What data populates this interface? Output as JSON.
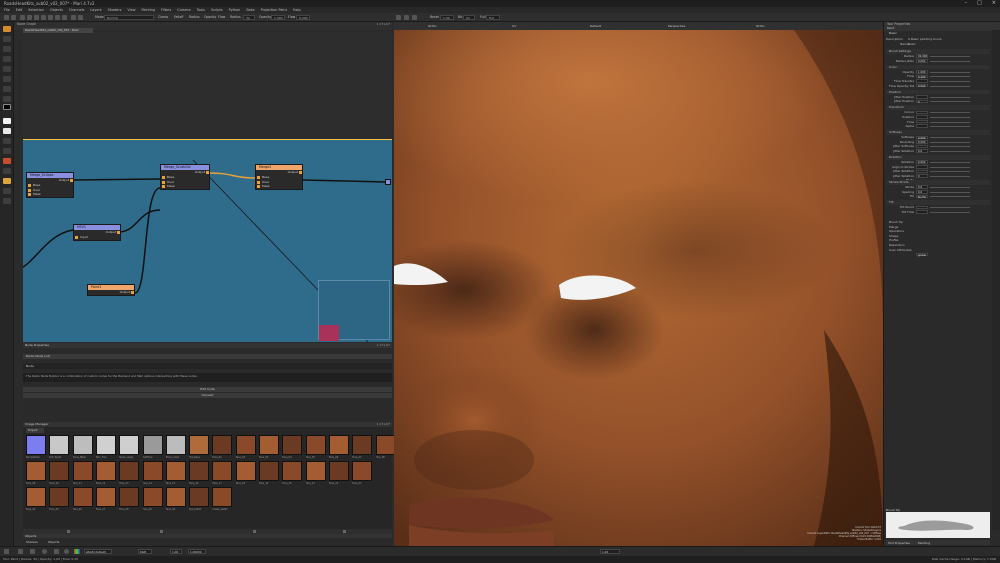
{
  "app": {
    "title": "RoadsHeadKits_sub02_v02_007* - Mari 4.7v2",
    "window_controls": [
      "–",
      "□",
      "×"
    ]
  },
  "menu": [
    "File",
    "Edit",
    "Selection",
    "Objects",
    "Channels",
    "Layers",
    "Shaders",
    "View",
    "Painting",
    "Filters",
    "Camera",
    "Tools",
    "Scripts",
    "Python",
    "Bake",
    "Projection Paint",
    "Help"
  ],
  "toolbar": {
    "mode_label": "Mode",
    "mode_value": "Normal",
    "options": [
      "Clamp",
      "Falloff",
      "Radius",
      "Opacity",
      "Flow"
    ],
    "radius_label": "Radius",
    "radius_value": "32",
    "opacity_label": "Opacity",
    "opacity_value": "1.000",
    "flow_label": "Flow",
    "flow_value": "0.200",
    "viewport_readout_a": "1.00",
    "viewport_readout_b": "On",
    "viewport_readout_c": "Full",
    "vp_label_a": "Reset",
    "vp_label_b": "Bit",
    "vp_label_c": "Full"
  },
  "node_graph": {
    "panel_title": "Node Graph",
    "tab": "RoadsHeadKits_sub02_v02_007 : Root",
    "zoom_readout": "1.171.67",
    "nodes": {
      "merge_a": {
        "title": "Merge_Eclipse",
        "rows": [
          "Base",
          "Over",
          "Mask"
        ],
        "out": "Output"
      },
      "merge_b": {
        "title": "Merge_Scratchd",
        "rows": [
          "Base",
          "Over",
          "Mask"
        ],
        "out": "Output"
      },
      "merge_c": {
        "title": "Merge2",
        "rows": [
          "Base",
          "Over",
          "Mask"
        ],
        "out": "Output"
      },
      "hsv": {
        "title": "HSV1",
        "rows": [
          "Input"
        ],
        "out": "Output"
      },
      "paint": {
        "title": "Paint1",
        "rows": [],
        "out": "Output"
      }
    }
  },
  "node_properties": {
    "panel_title": "Node Properties",
    "readout": "1.171.67",
    "section": "Radio Node (v2)",
    "field_label": "Node",
    "description": "The Radio Node Builder is a combination of custom nodes for the Backend and Mari options intersecting with these nodes.",
    "edit_button": "Edit Code",
    "convert_button": "Convert"
  },
  "image_manager": {
    "panel_title": "Image Manager",
    "readout": "1.171.67",
    "filter_label": "Project",
    "thumb_labels": [
      "NormalPlain",
      "Dirt_Spot1",
      "Pores_Mask",
      "Skin_Fine",
      "Noise_Large",
      "HalfTone",
      "Stone_Dark",
      "Tile_Base",
      "Face_01",
      "Face_02",
      "Face_03",
      "Face_04",
      "Face_05",
      "Face_06",
      "Face_07",
      "Face_08",
      "Face_09",
      "Face_10",
      "Face_11",
      "Face_12",
      "Face_13",
      "Face_14",
      "Face_15",
      "Face_16",
      "Face_17",
      "Face_18",
      "Face_19",
      "Face_20",
      "Face_21",
      "Face_22",
      "Face_23",
      "Face_24",
      "Face_25",
      "Face_26",
      "Face_27",
      "Face_28",
      "Face_29",
      "Face_30",
      "Eye_Detail",
      "Cheek_Detail"
    ]
  },
  "objects": {
    "panel_title": "Objects",
    "tabs": [
      "Shelves",
      "Objects"
    ]
  },
  "bottom_bar": {
    "color_label": "sRGB (default)",
    "view_label": "RGB",
    "zoom_value": "1.00",
    "gain_value": "1.00000"
  },
  "viewport": {
    "tabs": [
      "Ortho",
      "UV",
      "Default",
      "Perspective",
      "Ortho"
    ],
    "hud_lines": [
      "Current Tool: Paint/CT",
      "Shaders: Shaded/Layers",
      "Current Layer/Path: RoadsHeadKits_sub02_v02_007 > Diffuse",
      "Channel: Diffuse (8-bit 2048x2048)",
      "Frame Buffer: 1.00x"
    ],
    "bottom_readout": "1.00"
  },
  "tool_properties": {
    "panel_title": "Tool Properties",
    "tab": "Paint",
    "sub": "Basic",
    "description_label": "Description",
    "description_value": "A Basic painting brush",
    "name_label": "Name",
    "name_value": "Basic",
    "sections": [
      {
        "title": "Brush Settings",
        "rows": [
          [
            "Radius",
            "32.000"
          ],
          [
            "Radius Jitter",
            "0.000"
          ]
        ]
      },
      {
        "title": "Color",
        "rows": [
          [
            "Opacity",
            "1.000"
          ],
          [
            "Flow",
            "0.200"
          ],
          [
            "Flow Transfer",
            ""
          ],
          [
            "Flow Opacity Tilt",
            "0.000"
          ]
        ]
      },
      {
        "title": "Position",
        "rows": [
          [
            "Jitter Position",
            ""
          ],
          [
            "Jitter Position Mode",
            "0"
          ]
        ]
      },
      {
        "title": "Transform",
        "rows": [
          [
            "Colour",
            ""
          ],
          [
            "Position",
            ""
          ],
          [
            "Flow",
            ""
          ],
          [
            "Alpha",
            ""
          ]
        ]
      },
      {
        "title": "Softness",
        "rows": [
          [
            "Softness",
            "0.000"
          ],
          [
            "Rounding",
            "0.000"
          ],
          [
            "Jitter Softness",
            ""
          ],
          [
            "Jitter Rotation",
            "0.0"
          ]
        ]
      },
      {
        "title": "Rotation",
        "rows": [
          [
            "Rotation",
            "0.000"
          ],
          [
            "Align to Stroke",
            ""
          ],
          [
            "Jitter Rotation",
            ""
          ],
          [
            "Jitter Rotation Mode",
            "0"
          ]
        ]
      },
      {
        "title": "Stroke Stride",
        "rows": [
          [
            "Stride",
            "0.0"
          ],
          [
            "Spacing",
            "0.0"
          ],
          [
            "Fill",
            "No Fill"
          ]
        ]
      },
      {
        "title": "Tilt",
        "rows": [
          [
            "Tilt Pencil",
            ""
          ],
          [
            "Tilt Flow",
            ""
          ]
        ]
      }
    ],
    "collapsed_sections": [
      "Brush Tip",
      "Merge",
      "Operators",
      "Shape",
      "Profile",
      "Resolution",
      "User Attributes"
    ],
    "user_attr_value": "global",
    "brush_tip_title": "Brush Tip",
    "bottom_tabs": [
      "Tool Properties",
      "Painting"
    ]
  },
  "status": {
    "left": "Tool: Paint | Radius: 32 | Opacity: 1.00 | Flow: 0.20",
    "right": "Disk Cache Usage: 4.1GB | Memory: 7.2GB"
  },
  "colors": {
    "node_blue": "#2f6b8a",
    "merge_header": "#8a8fe0",
    "paint_header": "#f0a66a",
    "pin_orange": "#e9a23b",
    "accent_yellow": "#f5c243"
  }
}
